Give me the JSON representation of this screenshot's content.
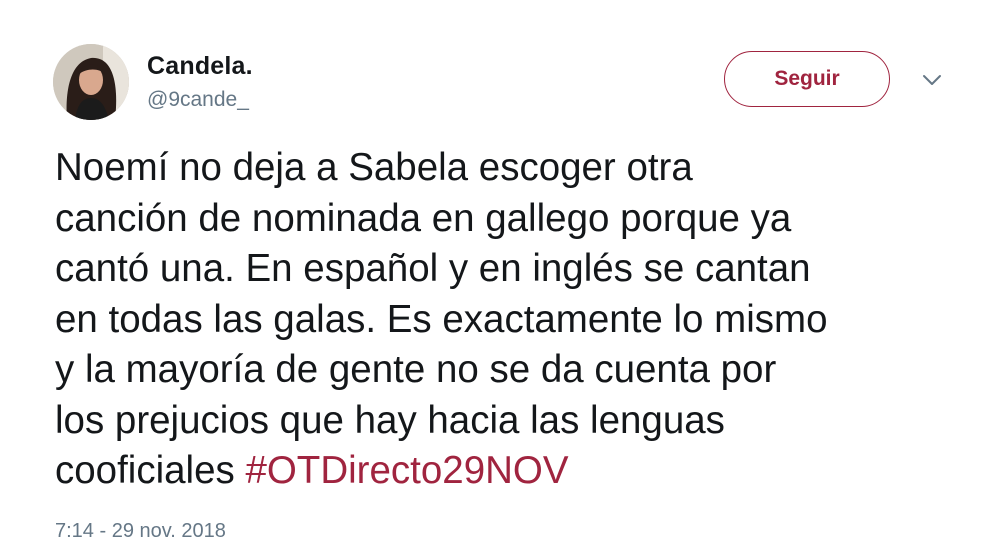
{
  "user": {
    "display_name": "Candela.",
    "handle": "@9cande_"
  },
  "follow_button": {
    "label": "Seguir"
  },
  "tweet": {
    "text": "Noemí no deja a Sabela escoger otra\ncanción de nominada en gallego porque ya\ncantó una. En español y en inglés se cantan\nen todas las galas. Es exactamente lo mismo\ny la mayoría de gente no se da cuenta por\nlos prejucios que hay hacia las lenguas\ncooficiales  ",
    "hashtag": "#OTDirecto29NOV",
    "timestamp": "7:14 - 29 nov. 2018"
  },
  "colors": {
    "accent": "#a0243f",
    "text_primary": "#14171a",
    "text_secondary": "#657786"
  },
  "icons": {
    "menu": "chevron-down-icon"
  }
}
